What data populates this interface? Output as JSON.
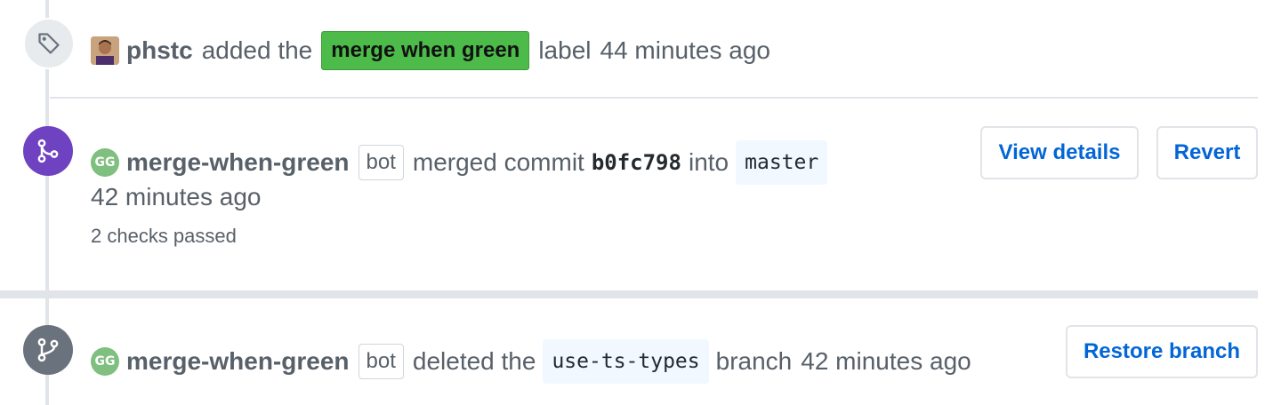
{
  "events": {
    "label": {
      "actor": "phstc",
      "action": "added the",
      "label_name": "merge when green",
      "suffix": "label",
      "time": "44 minutes ago",
      "icon": "tag-icon"
    },
    "merged": {
      "actor": "merge-when-green",
      "bot_tag": "bot",
      "action": "merged commit",
      "commit": "b0fc798",
      "into": "into",
      "branch": "master",
      "time": "42 minutes ago",
      "checks": "2 checks passed",
      "view_details_label": "View details",
      "revert_label": "Revert",
      "icon": "git-merge-icon",
      "avatar_text": "GG"
    },
    "deleted": {
      "actor": "merge-when-green",
      "bot_tag": "bot",
      "action": "deleted the",
      "branch": "use-ts-types",
      "suffix": "branch",
      "time": "42 minutes ago",
      "restore_label": "Restore branch",
      "icon": "git-branch-icon",
      "avatar_text": "GG"
    }
  },
  "colors": {
    "label_green": "#4cbb4a",
    "merged_purple": "#6f42c1",
    "link_blue": "#0366d6",
    "neutral_gray": "#6a737d"
  }
}
